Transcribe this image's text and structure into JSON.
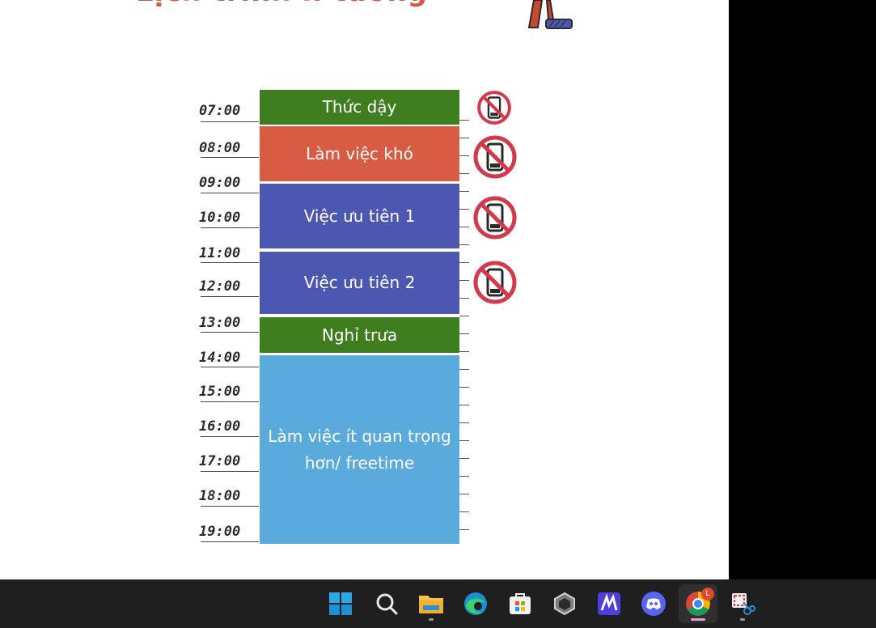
{
  "slide": {
    "title": "Lịch trình lí tưởng"
  },
  "times": [
    "07:00",
    "08:00",
    "09:00",
    "10:00",
    "11:00",
    "12:00",
    "13:00",
    "14:00",
    "15:00",
    "16:00",
    "17:00",
    "18:00",
    "19:00"
  ],
  "blocks": [
    {
      "label": "Thức dậy",
      "color": "#3f7e1f"
    },
    {
      "label": "Làm việc khó",
      "color": "#d85b43"
    },
    {
      "label": "Việc ưu tiên 1",
      "color": "#4b57b0"
    },
    {
      "label": "Việc ưu tiên 2",
      "color": "#4b57b0"
    },
    {
      "label": "Nghỉ trưa",
      "color": "#3f7e1f"
    },
    {
      "label": "Làm việc ít quan trọng hơn/ freetime",
      "color": "#5aabdb"
    }
  ],
  "icons": {
    "no_phone": "no-phone-icon",
    "colors": {
      "ring": "#d3394a",
      "phone": "#2a2a2a"
    }
  },
  "taskbar": {
    "items": [
      {
        "name": "windows-start-icon"
      },
      {
        "name": "search-icon"
      },
      {
        "name": "file-explorer-icon"
      },
      {
        "name": "edge-browser-icon"
      },
      {
        "name": "microsoft-store-icon"
      },
      {
        "name": "app-hexagon-icon"
      },
      {
        "name": "app-m-icon"
      },
      {
        "name": "discord-icon"
      },
      {
        "name": "chrome-icon",
        "badge": "L"
      },
      {
        "name": "snipping-tool-icon"
      }
    ]
  }
}
